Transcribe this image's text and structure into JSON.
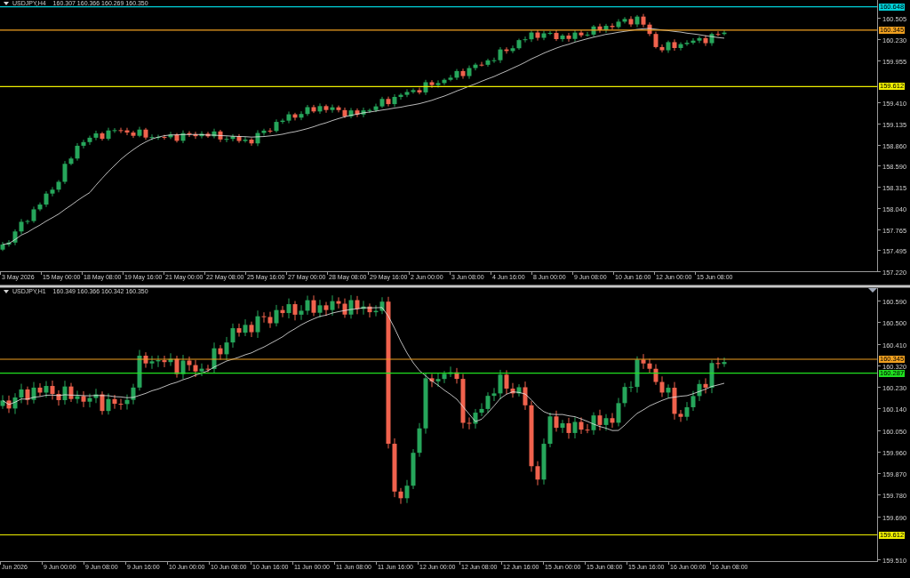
{
  "panes": [
    {
      "header": {
        "symbol": "USDJPY,H4",
        "quotes": "160.307 160.366 160.269 160.350"
      },
      "price_ticks": [
        "160.505",
        "160.230",
        "159.955",
        "159.410",
        "159.135",
        "158.860",
        "158.590",
        "158.315",
        "158.040",
        "157.765",
        "157.495",
        "157.220"
      ],
      "price_lines": [
        {
          "label": "160.648",
          "color": "#00d0d8"
        },
        {
          "label": "160.345",
          "color": "#f0a020"
        },
        {
          "label": "159.612",
          "color": "#f0f000"
        }
      ],
      "time_labels": [
        "3 May 2026",
        "15 May 00:00",
        "18 May 08:00",
        "19 May 16:00",
        "21 May 00:00",
        "22 May 08:00",
        "25 May 16:00",
        "27 May 00:00",
        "28 May 08:00",
        "29 May 16:00",
        "2 Jun 00:00",
        "3 Jun 08:00",
        "4 Jun 16:00",
        "8 Jun 00:00",
        "9 Jun 08:00",
        "10 Jun 16:00",
        "12 Jun 00:00",
        "15 Jun 08:00"
      ]
    },
    {
      "header": {
        "symbol": "USDJPY,H1",
        "quotes": "160.349 160.366 160.342 160.350"
      },
      "price_ticks": [
        "160.590",
        "160.500",
        "160.410",
        "160.320",
        "160.230",
        "160.140",
        "160.050",
        "159.960",
        "159.870",
        "159.780",
        "159.690",
        "159.510"
      ],
      "price_lines": [
        {
          "label": "160.345",
          "color": "#f0a020"
        },
        {
          "label": "160.287",
          "color": "#20e020"
        },
        {
          "label": "159.612",
          "color": "#f0f000"
        }
      ],
      "time_labels": [
        "Jun 2026",
        "9 Jun 00:00",
        "9 Jun 08:00",
        "9 Jun 16:00",
        "10 Jun 00:00",
        "10 Jun 08:00",
        "10 Jun 16:00",
        "11 Jun 00:00",
        "11 Jun 08:00",
        "11 Jun 16:00",
        "12 Jun 00:00",
        "12 Jun 08:00",
        "12 Jun 16:00",
        "15 Jun 00:00",
        "15 Jun 08:00",
        "15 Jun 16:00",
        "16 Jun 00:00",
        "16 Jun 08:00"
      ]
    }
  ]
}
